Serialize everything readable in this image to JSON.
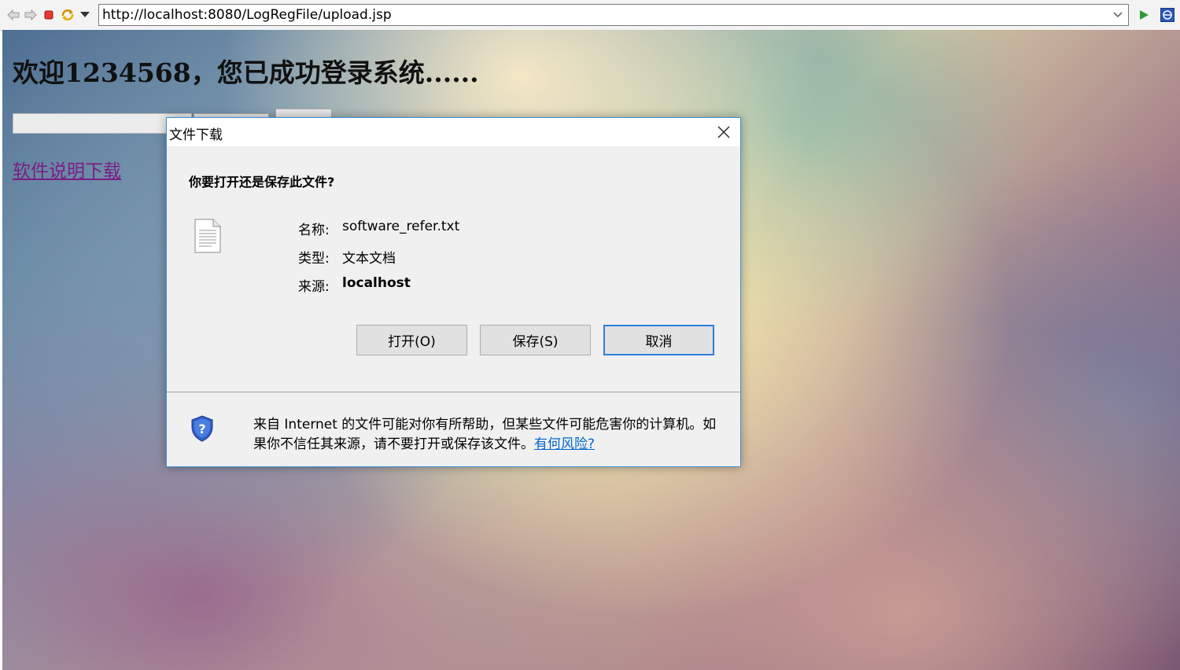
{
  "browser": {
    "url": "http://localhost:8080/LogRegFile/upload.jsp",
    "icons": [
      "back-icon",
      "forward-icon",
      "stop-icon",
      "refresh-icon",
      "menu-dropdown-icon",
      "address-dropdown-icon",
      "go-icon",
      "logo-icon"
    ]
  },
  "page": {
    "welcome_text": "欢迎1234568，您已成功登录系统......",
    "download_link": "软件说明下载",
    "link_color": "#7a1e86"
  },
  "dialog": {
    "title": "文件下载",
    "question": "你要打开还是保存此文件?",
    "info": [
      {
        "label": "名称:",
        "value": "software_refer.txt"
      },
      {
        "label": "类型:",
        "value": "文本文档"
      },
      {
        "label": "来源:",
        "value": "localhost"
      }
    ],
    "buttons": {
      "open": "打开(O)",
      "save": "保存(S)",
      "cancel": "取消"
    },
    "warning_text": "来自 Internet 的文件可能对你有所帮助，但某些文件可能危害你的计算机。如果你不信任其来源，请不要打开或保存该文件。",
    "risk_link": "有何风险?",
    "accent_color": "#2f7ed8"
  }
}
